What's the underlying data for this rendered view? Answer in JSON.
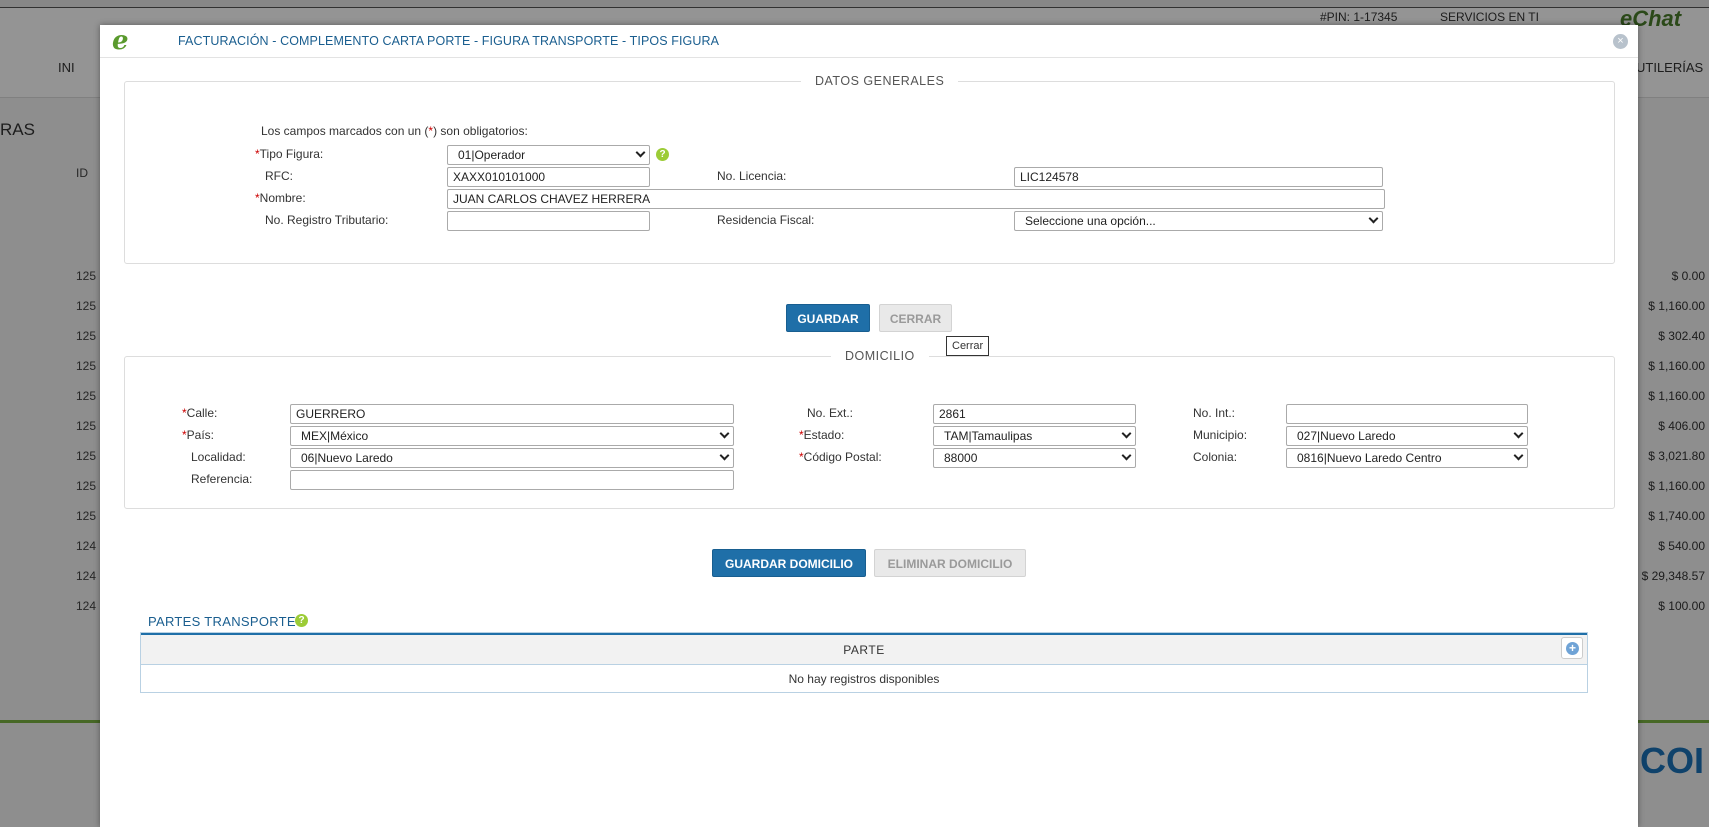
{
  "background": {
    "pin": "#PIN: 1-17345",
    "servicios": "SERVICIOS EN TI",
    "echat": "eChat",
    "inicio": "INI",
    "utilerias": "UTILERÍAS",
    "section": "RAS",
    "id_col": "ID",
    "rows": [
      {
        "id": "125",
        "amount": "$ 0.00"
      },
      {
        "id": "125",
        "amount": "$ 1,160.00"
      },
      {
        "id": "125",
        "amount": "$ 302.40"
      },
      {
        "id": "125",
        "amount": "$ 1,160.00"
      },
      {
        "id": "125",
        "amount": "$ 1,160.00"
      },
      {
        "id": "125",
        "amount": "$ 406.00"
      },
      {
        "id": "125",
        "amount": "$ 3,021.80"
      },
      {
        "id": "125",
        "amount": "$ 1,160.00"
      },
      {
        "id": "125",
        "amount": "$ 1,740.00"
      },
      {
        "id": "124",
        "amount": "$ 540.00"
      },
      {
        "id": "124",
        "amount": "$ 29,348.57"
      },
      {
        "id": "124",
        "amount": "$ 100.00"
      }
    ],
    "footer_logo": "COI"
  },
  "modal": {
    "logo": "e",
    "title": "FACTURACIÓN - COMPLEMENTO CARTA PORTE - FIGURA TRANSPORTE - TIPOS FIGURA",
    "close": "×"
  },
  "datos_generales": {
    "legend": "DATOS GENERALES",
    "note_prefix": "Los campos marcados con un (",
    "note_star": "*",
    "note_suffix": ") son obligatorios:",
    "tipo_figura_label": "Tipo Figura:",
    "tipo_figura_value": "01|Operador",
    "rfc_label": "RFC:",
    "rfc_value": "XAXX010101000",
    "licencia_label": "No. Licencia:",
    "licencia_value": "LIC124578",
    "nombre_label": "Nombre:",
    "nombre_value": "JUAN CARLOS CHAVEZ HERRERA",
    "registro_label": "No. Registro Tributario:",
    "registro_value": "",
    "residencia_label": "Residencia Fiscal:",
    "residencia_value": "Seleccione una opción..."
  },
  "buttons": {
    "guardar": "GUARDAR",
    "cerrar": "CERRAR",
    "tooltip": "Cerrar",
    "guardar_domicilio": "GUARDAR DOMICILIO",
    "eliminar_domicilio": "ELIMINAR DOMICILIO"
  },
  "domicilio": {
    "legend": "DOMICILIO",
    "calle_label": "Calle:",
    "calle_value": "GUERRERO",
    "no_ext_label": "No. Ext.:",
    "no_ext_value": "2861",
    "no_int_label": "No. Int.:",
    "no_int_value": "",
    "pais_label": "País:",
    "pais_value": "MEX|México",
    "estado_label": "Estado:",
    "estado_value": "TAM|Tamaulipas",
    "municipio_label": "Municipio:",
    "municipio_value": "027|Nuevo Laredo",
    "localidad_label": "Localidad:",
    "localidad_value": "06|Nuevo Laredo",
    "cp_label": "Código Postal:",
    "cp_value": "88000",
    "colonia_label": "Colonia:",
    "colonia_value": "0816|Nuevo Laredo Centro",
    "referencia_label": "Referencia:",
    "referencia_value": ""
  },
  "partes": {
    "title": "PARTES TRANSPORTE",
    "column": "PARTE",
    "empty": "No hay registros disponibles"
  },
  "help_glyph": "?",
  "add_glyph": "+",
  "colors": {
    "primary": "#1f6fa8",
    "accent_green": "#9ccc37",
    "required": "#cc0000"
  }
}
